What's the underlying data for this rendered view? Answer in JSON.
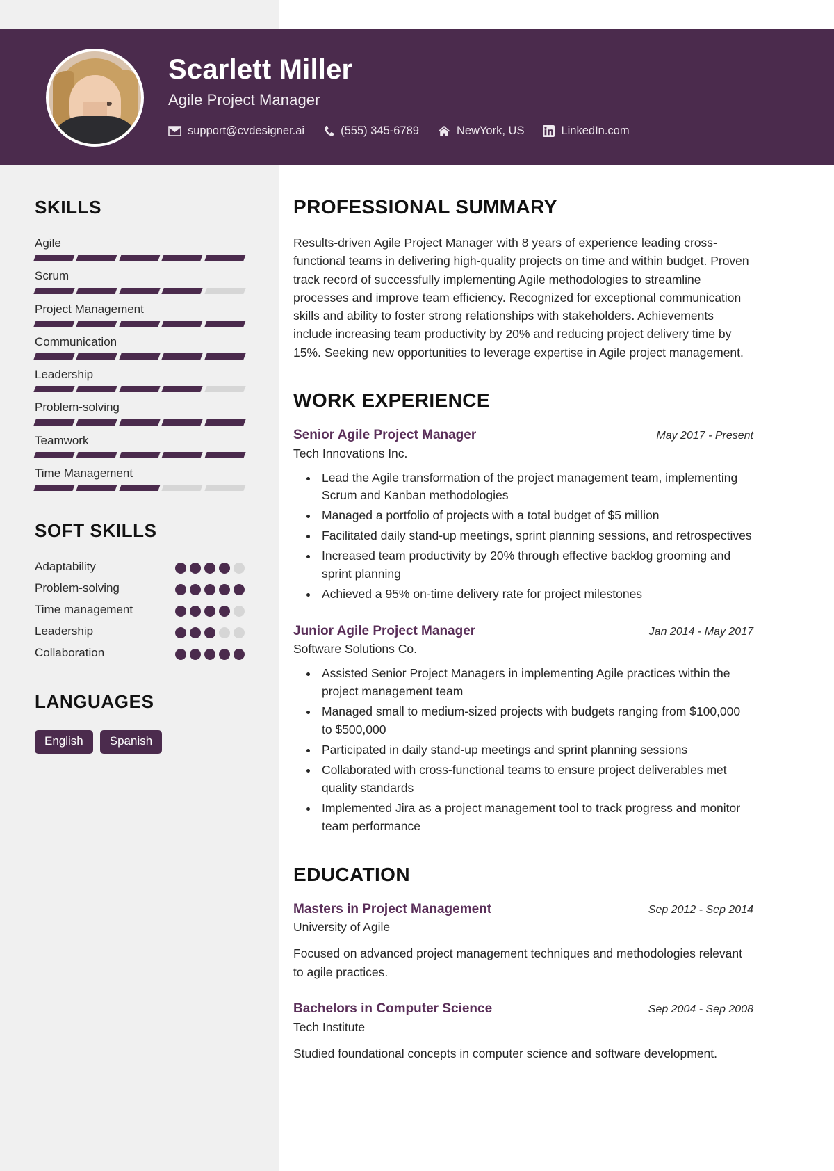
{
  "header": {
    "name": "Scarlett Miller",
    "job_title": "Agile Project Manager",
    "accent_color": "#4b2b4d",
    "contacts": [
      {
        "icon": "envelope-icon",
        "text": "support@cvdesigner.ai"
      },
      {
        "icon": "phone-icon",
        "text": "(555) 345-6789"
      },
      {
        "icon": "home-icon",
        "text": "NewYork, US"
      },
      {
        "icon": "linkedin-icon",
        "text": "LinkedIn.com"
      }
    ]
  },
  "sidebar": {
    "skills_heading": "SKILLS",
    "skills": [
      {
        "label": "Agile",
        "level": 5,
        "max": 5
      },
      {
        "label": "Scrum",
        "level": 4,
        "max": 5
      },
      {
        "label": "Project Management",
        "level": 5,
        "max": 5
      },
      {
        "label": "Communication",
        "level": 5,
        "max": 5
      },
      {
        "label": "Leadership",
        "level": 4,
        "max": 5
      },
      {
        "label": "Problem-solving",
        "level": 5,
        "max": 5
      },
      {
        "label": "Teamwork",
        "level": 5,
        "max": 5
      },
      {
        "label": "Time Management",
        "level": 3,
        "max": 5
      }
    ],
    "soft_skills_heading": "SOFT SKILLS",
    "soft_skills": [
      {
        "label": "Adaptability",
        "level": 4,
        "max": 5
      },
      {
        "label": "Problem-solving",
        "level": 5,
        "max": 5
      },
      {
        "label": "Time management",
        "level": 4,
        "max": 5
      },
      {
        "label": "Leadership",
        "level": 3,
        "max": 5
      },
      {
        "label": "Collaboration",
        "level": 5,
        "max": 5
      }
    ],
    "languages_heading": "LANGUAGES",
    "languages": [
      "English",
      "Spanish"
    ]
  },
  "main": {
    "summary_heading": "PROFESSIONAL SUMMARY",
    "summary": "Results-driven Agile Project Manager with 8 years of experience leading cross-functional teams in delivering high-quality projects on time and within budget. Proven track record of successfully implementing Agile methodologies to streamline processes and improve team efficiency. Recognized for exceptional communication skills and ability to foster strong relationships with stakeholders. Achievements include increasing team productivity by 20% and reducing project delivery time by 15%. Seeking new opportunities to leverage expertise in Agile project management.",
    "experience_heading": "WORK EXPERIENCE",
    "experience": [
      {
        "role": "Senior Agile Project Manager",
        "date": "May 2017 - Present",
        "org": "Tech Innovations Inc.",
        "bullets": [
          "Lead the Agile transformation of the project management team, implementing Scrum and Kanban methodologies",
          "Managed a portfolio of projects with a total budget of $5 million",
          "Facilitated daily stand-up meetings, sprint planning sessions, and retrospectives",
          "Increased team productivity by 20% through effective backlog grooming and sprint planning",
          "Achieved a 95% on-time delivery rate for project milestones"
        ]
      },
      {
        "role": "Junior Agile Project Manager",
        "date": "Jan 2014 - May 2017",
        "org": "Software Solutions Co.",
        "bullets": [
          "Assisted Senior Project Managers in implementing Agile practices within the project management team",
          "Managed small to medium-sized projects with budgets ranging from $100,000 to $500,000",
          "Participated in daily stand-up meetings and sprint planning sessions",
          "Collaborated with cross-functional teams to ensure project deliverables met quality standards",
          "Implemented Jira as a project management tool to track progress and monitor team performance"
        ]
      }
    ],
    "education_heading": "EDUCATION",
    "education": [
      {
        "degree": "Masters in Project Management",
        "date": "Sep 2012 - Sep 2014",
        "school": "University of Agile",
        "description": "Focused on advanced project management techniques and methodologies relevant to agile practices."
      },
      {
        "degree": "Bachelors in Computer Science",
        "date": "Sep 2004 - Sep 2008",
        "school": "Tech Institute",
        "description": "Studied foundational concepts in computer science and software development."
      }
    ]
  }
}
